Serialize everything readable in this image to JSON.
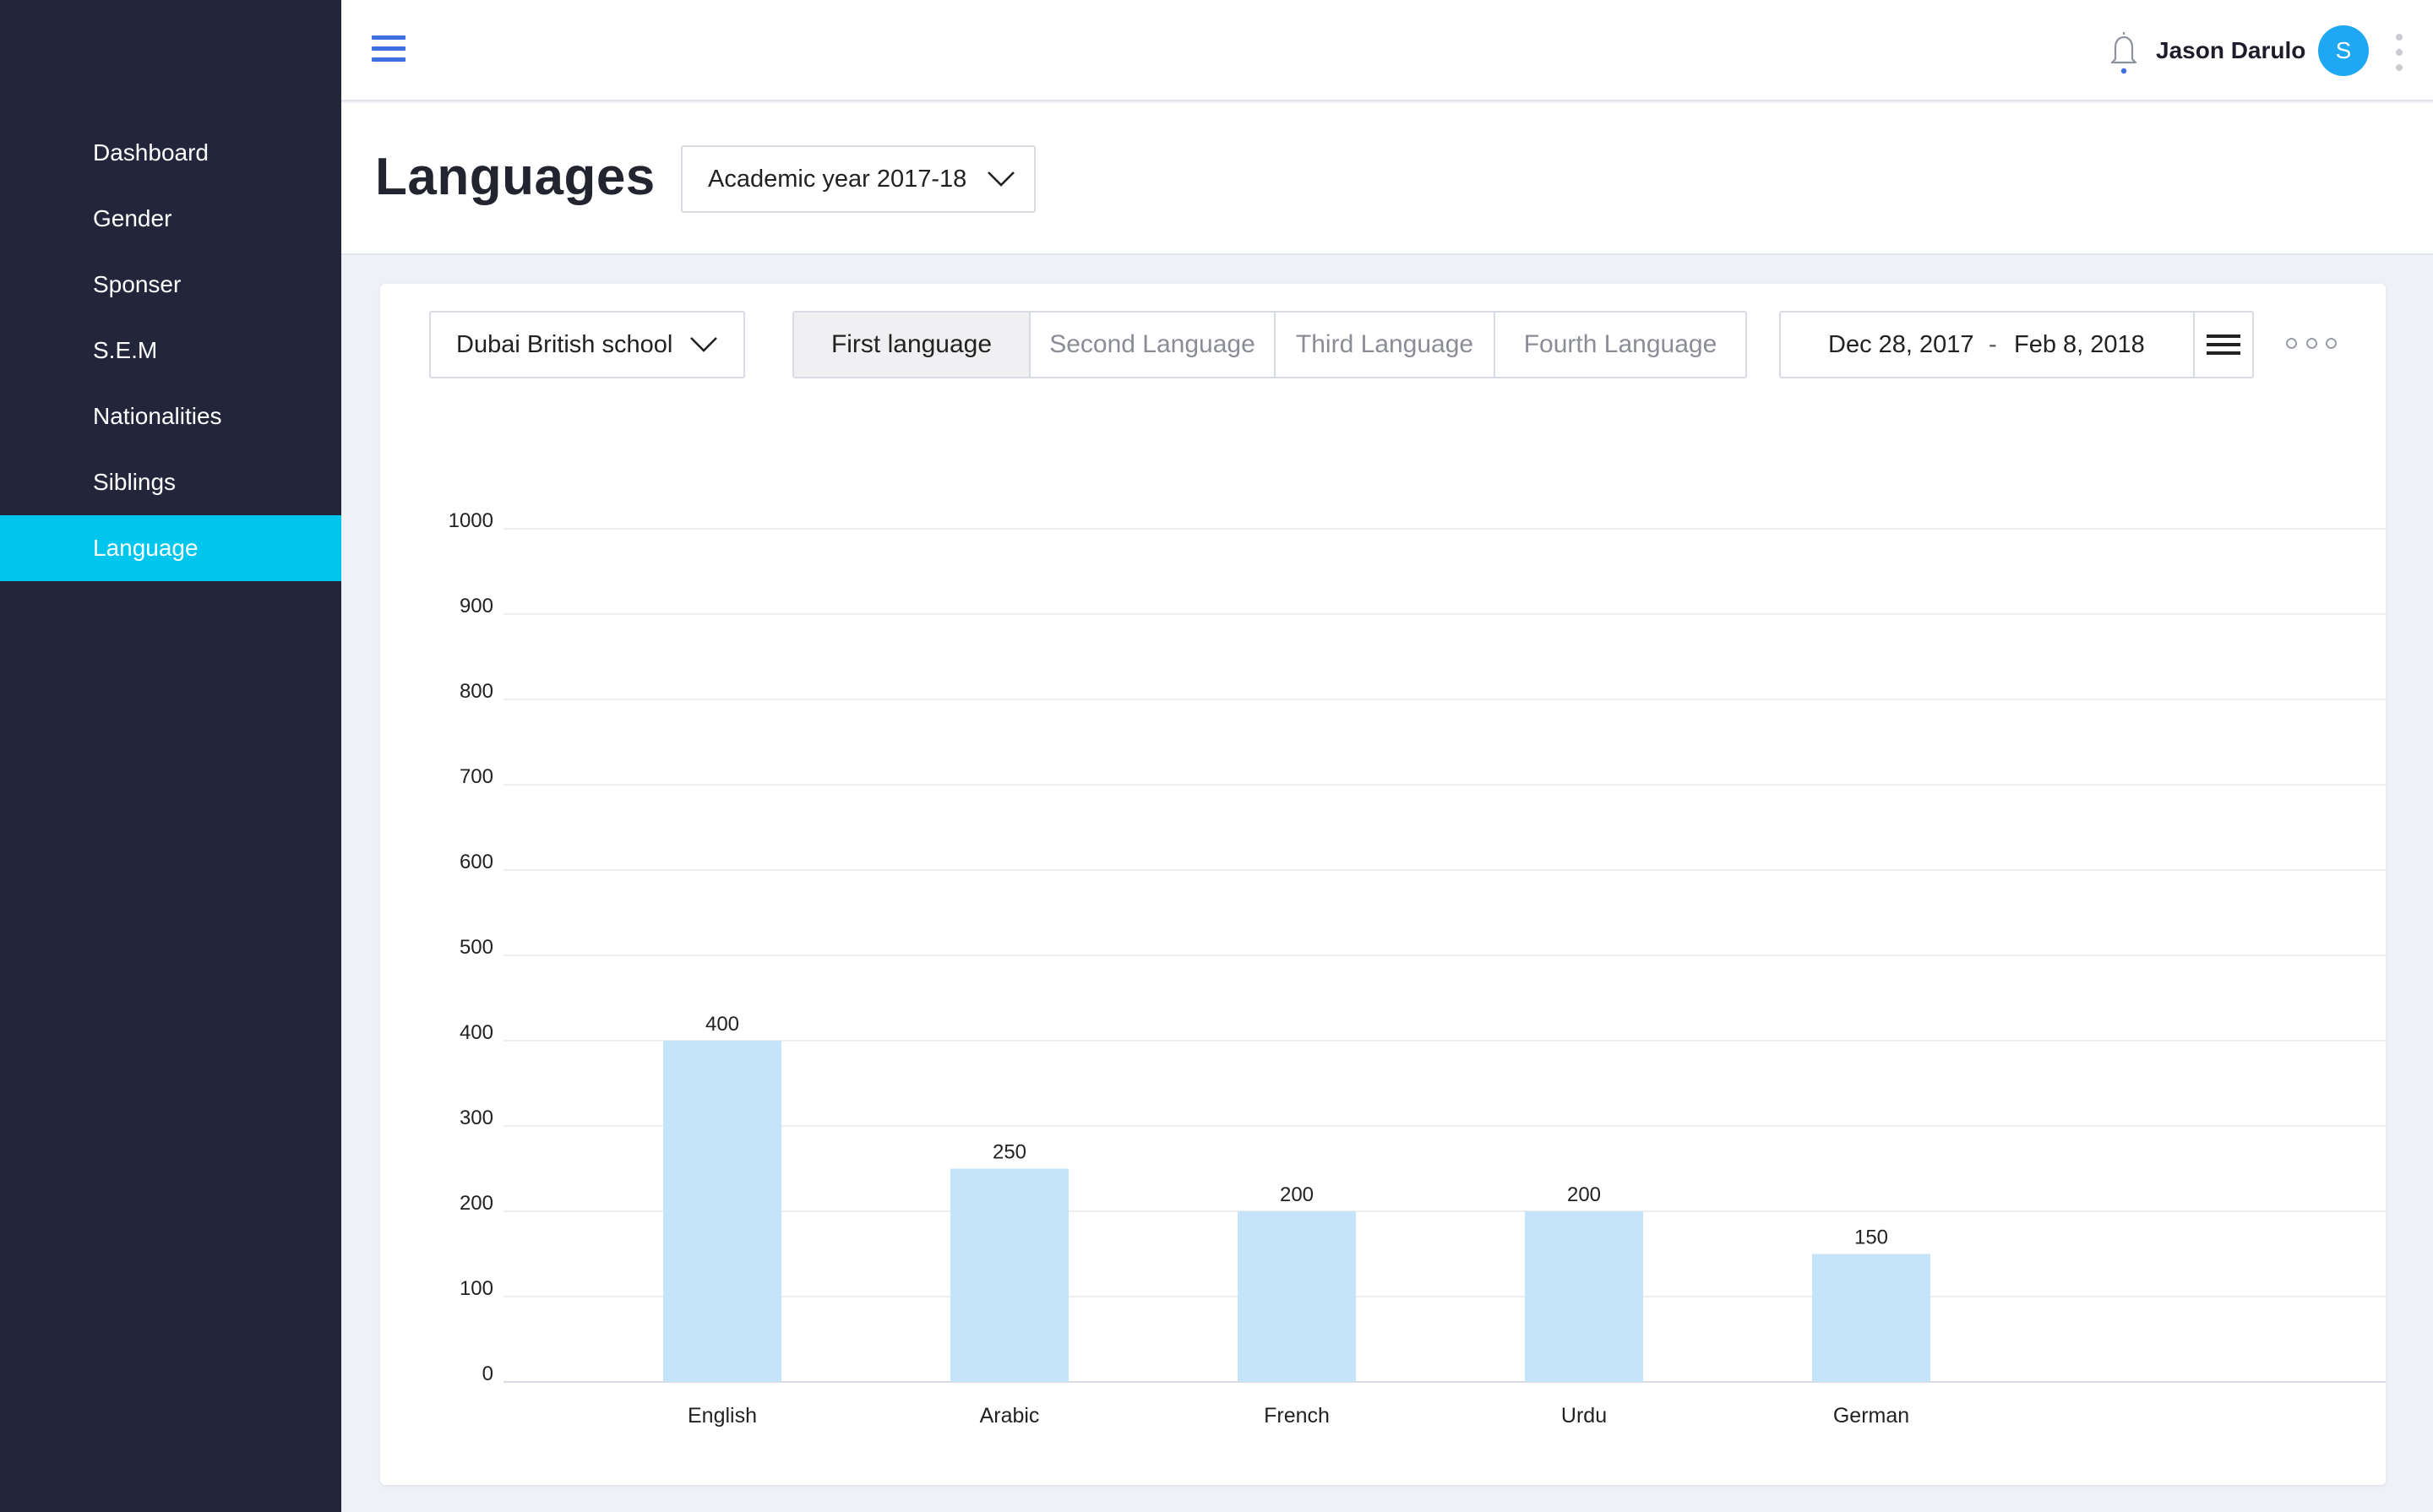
{
  "sidebar": {
    "items": [
      {
        "label": "Dashboard",
        "active": false
      },
      {
        "label": "Gender",
        "active": false
      },
      {
        "label": "Sponser",
        "active": false
      },
      {
        "label": "S.E.M",
        "active": false
      },
      {
        "label": "Nationalities",
        "active": false
      },
      {
        "label": "Siblings",
        "active": false
      },
      {
        "label": "Language",
        "active": true
      }
    ],
    "colors": {
      "background": "#23263a",
      "active": "#00c6ee"
    }
  },
  "topbar": {
    "menu_icon": "hamburger-icon",
    "notification_icon": "bell-icon",
    "user_name": "Jason Darulo",
    "avatar_initial": "S",
    "more_icon": "kebab-icon"
  },
  "header": {
    "title": "Languages",
    "year_select": {
      "value": "Academic year 2017-18",
      "icon": "chevron-down-icon"
    }
  },
  "filters": {
    "school_select": {
      "value": "Dubai British school",
      "icon": "chevron-down-icon"
    },
    "tabs": [
      {
        "label": "First language",
        "active": true
      },
      {
        "label": "Second Language",
        "active": false
      },
      {
        "label": "Third Language",
        "active": false
      },
      {
        "label": "Fourth Language",
        "active": false
      }
    ],
    "date_range": {
      "from": "Dec 28, 2017",
      "separator": "-",
      "to": "Feb 8, 2018",
      "menu_icon": "list-icon"
    },
    "more_icon": "more-horizontal-icon"
  },
  "chart_data": {
    "type": "bar",
    "categories": [
      "English",
      "Arabic",
      "French",
      "Urdu",
      "German"
    ],
    "values": [
      400,
      250,
      200,
      200,
      150
    ],
    "data_labels": [
      "400",
      "250",
      "200",
      "200",
      "150"
    ],
    "y_ticks": [
      "0",
      "100",
      "200",
      "300",
      "400",
      "500",
      "600",
      "700",
      "800",
      "900",
      "1000"
    ],
    "ylim": [
      0,
      1000
    ],
    "grid": true,
    "bar_color": "#c5e4f9"
  }
}
